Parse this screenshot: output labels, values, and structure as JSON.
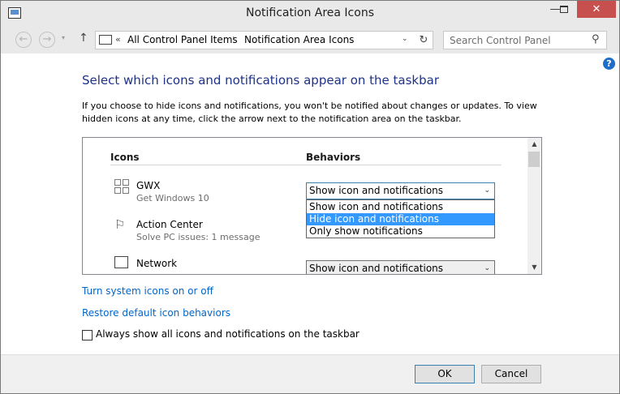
{
  "window": {
    "title": "Notification Area Icons",
    "controls": {
      "minimize": "—",
      "maximize": "",
      "close": "✕"
    }
  },
  "nav": {
    "back": "←",
    "forward": "→",
    "recent": "▾",
    "up": "↑",
    "address_chevron": "«",
    "breadcrumbs": [
      "All Control Panel Items",
      "Notification Area Icons"
    ],
    "breadcrumb_separator": "›",
    "address_dropdown": "⌄",
    "refresh": "↻",
    "search_placeholder": "Search Control Panel",
    "search_icon": "⚲"
  },
  "help_icon": "?",
  "main": {
    "title": "Select which icons and notifications appear on the taskbar",
    "intro": "If you choose to hide icons and notifications, you won't be notified about changes or updates. To view hidden icons at any time, click the arrow next to the notification area on the taskbar.",
    "columns": {
      "icons": "Icons",
      "behaviors": "Behaviors"
    },
    "rows": [
      {
        "name": "GWX",
        "sub": "Get Windows 10",
        "behavior": "Show icon and notifications",
        "icon": "windows-logo-icon"
      },
      {
        "name": "Action Center",
        "sub": "Solve PC issues: 1 message",
        "behavior": "",
        "icon": "flag-icon"
      },
      {
        "name": "Network",
        "sub": "",
        "behavior": "Show icon and notifications",
        "icon": "network-icon"
      }
    ],
    "dropdown_options": [
      "Show icon and notifications",
      "Hide icon and notifications",
      "Only show notifications"
    ],
    "dropdown_highlighted": 1,
    "dropdown_arrow": "⌄",
    "scroll_up": "▲",
    "scroll_down": "▼"
  },
  "links": {
    "system_icons": "Turn system icons on or off",
    "restore": "Restore default icon behaviors"
  },
  "always_show": {
    "label": "Always show all icons and notifications on the taskbar",
    "checked": false
  },
  "buttons": {
    "ok": "OK",
    "cancel": "Cancel"
  },
  "colors": {
    "title_text": "#1e3287",
    "link": "#0066cc",
    "highlight": "#3399ff",
    "close_button": "#c7504f"
  }
}
